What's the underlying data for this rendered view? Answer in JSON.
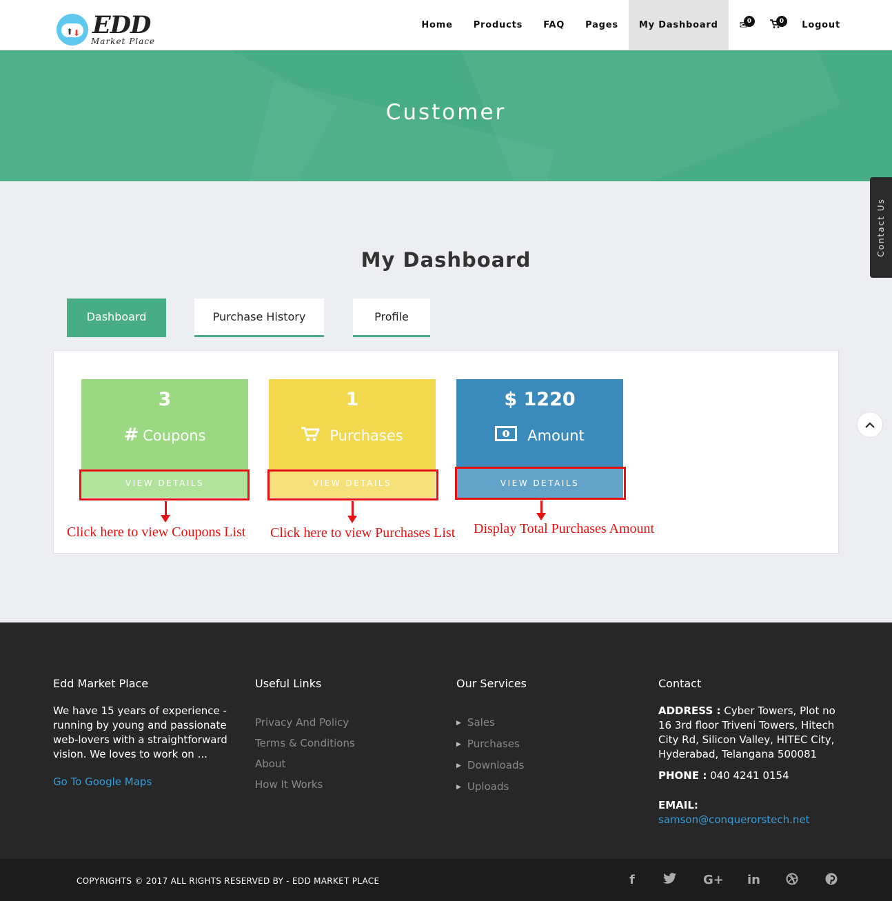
{
  "brand": {
    "title": "EDD",
    "subtitle": "Market Place"
  },
  "nav": {
    "items": [
      "Home",
      "Products",
      "FAQ",
      "Pages",
      "My Dashboard"
    ],
    "active": "My Dashboard",
    "mail_count": "0",
    "cart_count": "0",
    "logout": "Logout"
  },
  "hero": {
    "title": "Customer"
  },
  "contact_tab": "Contact Us",
  "dashboard": {
    "title": "My Dashboard",
    "tabs": [
      "Dashboard",
      "Purchase History",
      "Profile"
    ],
    "active_tab": "Dashboard",
    "cards": [
      {
        "number": "3",
        "icon": "hash-icon",
        "label": "Coupons",
        "action": "VIEW DETAILS",
        "color": "#9ad981",
        "bottom_color": "#b2e39c"
      },
      {
        "number": "1",
        "icon": "cart-icon",
        "label": "Purchases",
        "action": "VIEW DETAILS",
        "color": "#f2d84c",
        "bottom_color": "#f6e07a"
      },
      {
        "number": "$ 1220",
        "icon": "money-icon",
        "label": "Amount",
        "action": "VIEW DETAILS",
        "color": "#3a8bbc",
        "bottom_color": "#63a3ca"
      }
    ],
    "annotations": [
      "Click here to view Coupons List",
      "Click here to view Purchases List",
      "Display Total Purchases Amount"
    ]
  },
  "footer": {
    "about": {
      "heading": "Edd Market Place",
      "text": "We have 15 years of experience - running by young and passionate web-lovers with a straightforward vision. We loves to work on ...",
      "link": "Go To Google Maps"
    },
    "useful_links": {
      "heading": "Useful Links",
      "items": [
        "Privacy And Policy",
        "Terms & Conditions",
        "About",
        "How It Works"
      ]
    },
    "services": {
      "heading": "Our Services",
      "items": [
        "Sales",
        "Purchases",
        "Downloads",
        "Uploads"
      ]
    },
    "contact": {
      "heading": "Contact",
      "address_label": "ADDRESS :",
      "address": "Cyber Towers, Plot no 16 3rd floor Triveni Towers, Hitech City Rd, Silicon Valley, HITEC City, Hyderabad, Telangana 500081",
      "phone_label": "PHONE :",
      "phone": "040 4241 0154",
      "email_label": "EMAIL:",
      "email": "samson@conquerorstech.net"
    },
    "copyright": "COPYRIGHTS © 2017 ALL RIGHTS RESERVED BY - EDD MARKET PLACE",
    "social": [
      "facebook-icon",
      "twitter-icon",
      "google-plus-icon",
      "linkedin-icon",
      "dribbble-icon",
      "pinterest-icon"
    ]
  },
  "colors": {
    "accent": "#48ad86",
    "annotation": "#e81010",
    "footer": "#272727"
  }
}
